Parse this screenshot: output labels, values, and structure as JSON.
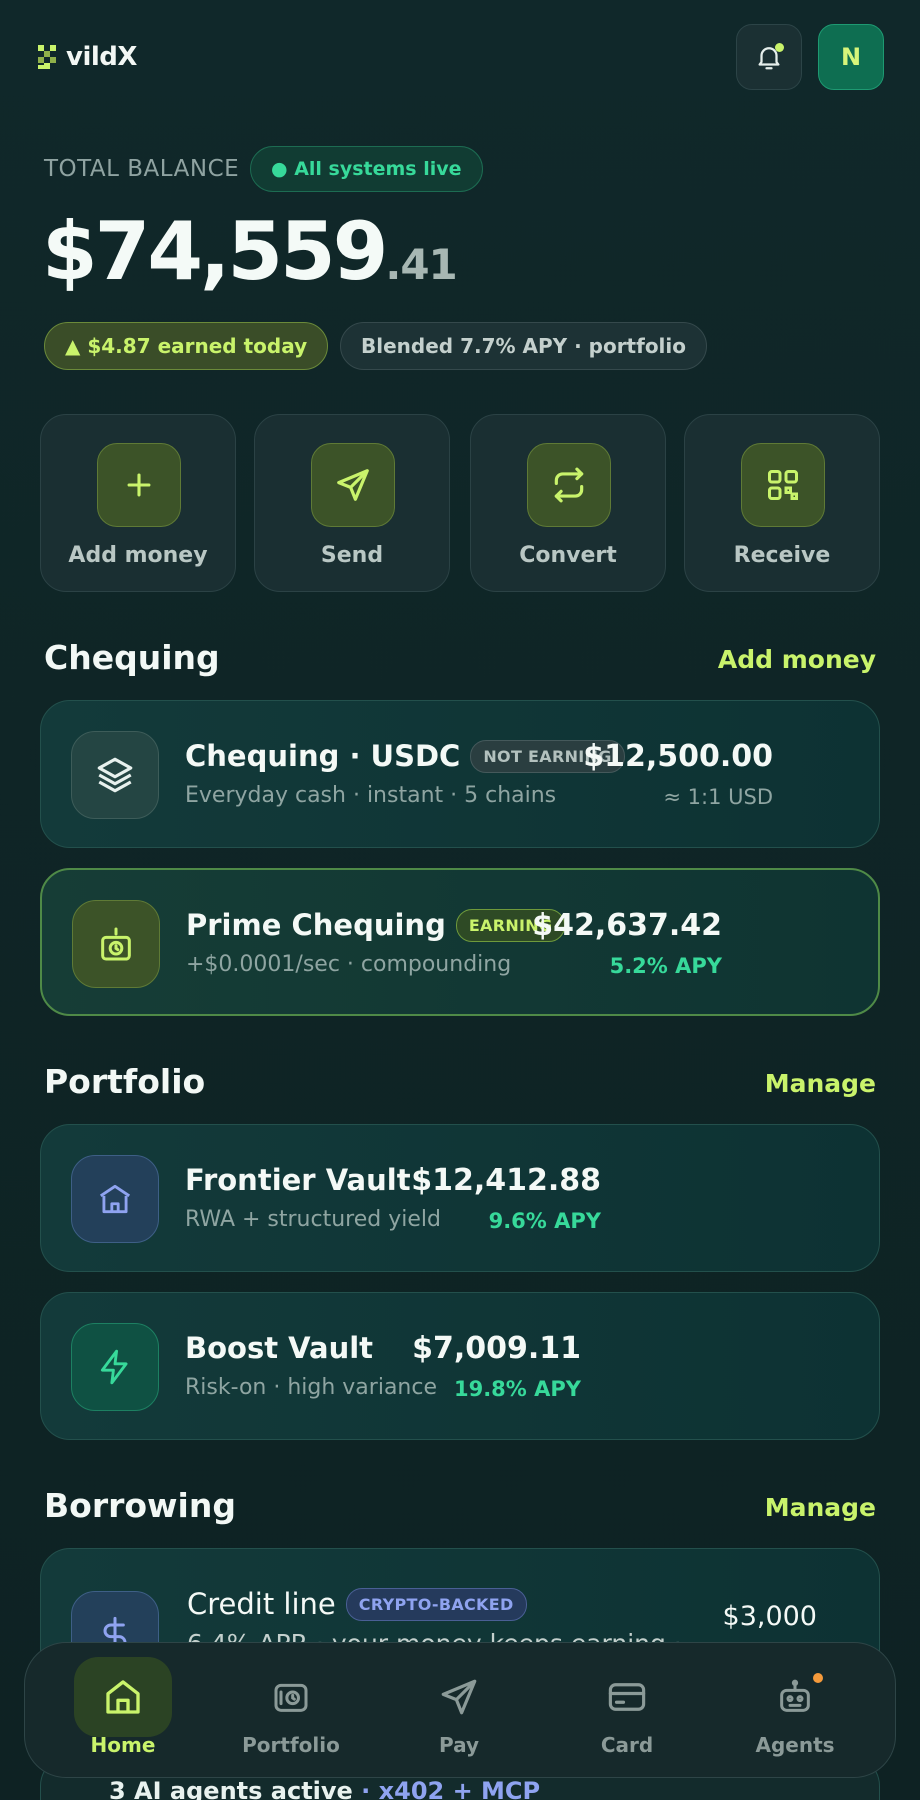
{
  "header": {
    "brand": "vildX",
    "avatar_initial": "N"
  },
  "balance": {
    "label": "TOTAL BALANCE",
    "status": "● All systems live",
    "whole": "$74,559",
    "cents": ".41",
    "earned": "▲ $4.87 earned today",
    "blended": "Blended 7.7% APY · portfolio"
  },
  "actions": [
    {
      "label": "Add money",
      "icon": "plus-icon"
    },
    {
      "label": "Send",
      "icon": "send-icon"
    },
    {
      "label": "Convert",
      "icon": "convert-icon"
    },
    {
      "label": "Receive",
      "icon": "qr-icon"
    }
  ],
  "chequing": {
    "title": "Chequing",
    "link": "Add money",
    "accounts": [
      {
        "name": "Chequing · USDC",
        "badge": "NOT EARNING",
        "sub": "Everyday cash · instant · 5 chains",
        "amount": "$12,500.00",
        "meta": "≈ 1:1 USD"
      },
      {
        "name": "Prime Chequing",
        "badge": "EARNING",
        "sub": "+$0.0001/sec · compounding",
        "amount": "$42,637.42",
        "meta": "5.2% APY"
      }
    ]
  },
  "portfolio": {
    "title": "Portfolio",
    "link": "Manage",
    "vaults": [
      {
        "name": "Frontier Vault",
        "sub": "RWA + structured yield",
        "amount": "$12,412.88",
        "meta": "9.6% APY"
      },
      {
        "name": "Boost Vault",
        "sub": "Risk-on · high variance",
        "amount": "$7,009.11",
        "meta": "19.8% APY"
      }
    ]
  },
  "borrowing": {
    "title": "Borrowing",
    "link": "Manage",
    "credit": {
      "name": "Credit line",
      "badge": "CRYPTO-BACKED",
      "sub": "6.4% APR · your money keeps earning ·",
      "amount": "$3,000"
    }
  },
  "agents_peek": {
    "text": "3 AI agents active",
    "detail": " · x402 + MCP"
  },
  "nav": [
    {
      "label": "Home",
      "icon": "home-icon",
      "active": true
    },
    {
      "label": "Portfolio",
      "icon": "portfolio-icon"
    },
    {
      "label": "Pay",
      "icon": "pay-icon"
    },
    {
      "label": "Card",
      "icon": "card-icon"
    },
    {
      "label": "Agents",
      "icon": "robot-icon"
    }
  ],
  "colors": {
    "accent": "#c9f36b",
    "success": "#37d99a",
    "background": "#10282a",
    "purple": "#8fa3f0"
  }
}
